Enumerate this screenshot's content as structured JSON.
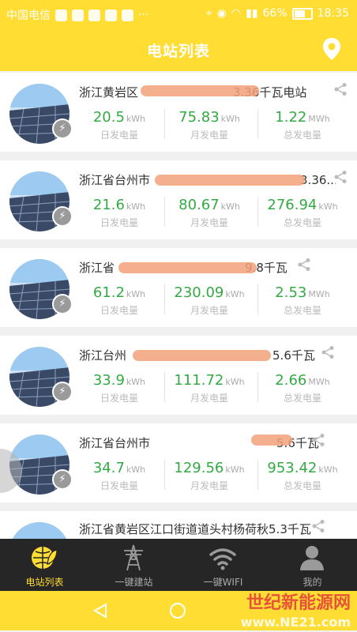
{
  "status": {
    "carrier": "中国电信",
    "battery": "66%",
    "time": "18:35"
  },
  "appbar": {
    "title": "电站列表"
  },
  "labels": {
    "daily": "日发电量",
    "monthly": "月发电量",
    "total": "总发电量"
  },
  "stations": [
    {
      "name": "浙江黄岩区",
      "name_tail": "3.36千瓦电站",
      "daily": "20.5",
      "daily_unit": "kWh",
      "monthly": "75.83",
      "monthly_unit": "kWh",
      "total": "1.22",
      "total_unit": "MWh"
    },
    {
      "name": "浙江省台州市",
      "name_tail": "3.36...",
      "daily": "21.6",
      "daily_unit": "kWh",
      "monthly": "80.67",
      "monthly_unit": "kWh",
      "total": "276.94",
      "total_unit": "kWh"
    },
    {
      "name": "浙江省",
      "name_tail": "9.8千瓦",
      "daily": "61.2",
      "daily_unit": "kWh",
      "monthly": "230.09",
      "monthly_unit": "kWh",
      "total": "2.53",
      "total_unit": "MWh"
    },
    {
      "name": "浙江台州",
      "name_tail": "5.6千瓦",
      "daily": "33.9",
      "daily_unit": "kWh",
      "monthly": "111.72",
      "monthly_unit": "kWh",
      "total": "2.66",
      "total_unit": "MWh"
    },
    {
      "name": "浙江省台州市",
      "name_tail": "5.6千瓦",
      "daily": "34.7",
      "daily_unit": "kWh",
      "monthly": "129.56",
      "monthly_unit": "kWh",
      "total": "953.42",
      "total_unit": "kWh"
    },
    {
      "name": "浙江省黄岩区江口街道道头村杨荷秋5.3千瓦",
      "name_tail": ""
    }
  ],
  "tabs": [
    {
      "label": "电站列表",
      "icon": "globe-leaf-icon"
    },
    {
      "label": "一键建站",
      "icon": "power-tower-icon"
    },
    {
      "label": "一键WIFI",
      "icon": "wifi-icon"
    },
    {
      "label": "我的",
      "icon": "person-icon"
    }
  ],
  "watermark": {
    "line1": "世纪新能源网",
    "line2": "www.NE21.com"
  },
  "colors": {
    "accent": "#ffdd33",
    "value_green": "#33aa44",
    "tabbar": "#262626",
    "redaction": "#f2a27a"
  }
}
